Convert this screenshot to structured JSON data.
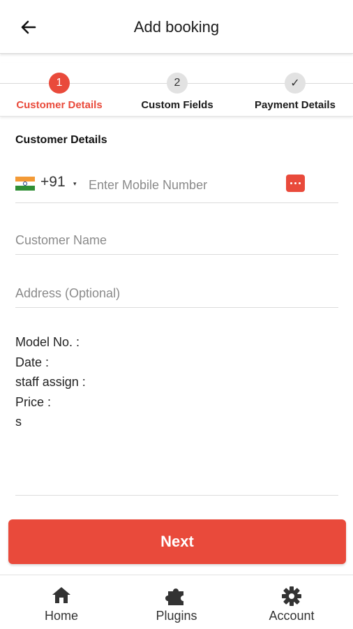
{
  "header": {
    "title": "Add booking",
    "back_icon": "arrow-left-icon"
  },
  "stepper": {
    "steps": [
      {
        "number": "1",
        "label": "Customer Details",
        "state": "active"
      },
      {
        "number": "2",
        "label": "Custom Fields",
        "state": "todo"
      },
      {
        "number": "✓",
        "label": "Payment Details",
        "state": "todo"
      }
    ]
  },
  "form": {
    "section_title": "Customer Details",
    "country_code": "+91",
    "caret": "▾",
    "mobile_placeholder": "Enter Mobile Number",
    "name_placeholder": "Customer Name",
    "address_placeholder": "Address (Optional)",
    "notes": [
      "Model No. :",
      "Date :",
      "staff assign :",
      "Price :",
      "s"
    ]
  },
  "actions": {
    "next_label": "Next"
  },
  "bottom_nav": [
    {
      "label": "Home",
      "icon": "home-icon"
    },
    {
      "label": "Plugins",
      "icon": "puzzle-icon"
    },
    {
      "label": "Account",
      "icon": "gear-icon"
    }
  ],
  "colors": {
    "accent": "#e94a3b",
    "text": "#1a1a1a",
    "muted": "#8a8a8a"
  }
}
